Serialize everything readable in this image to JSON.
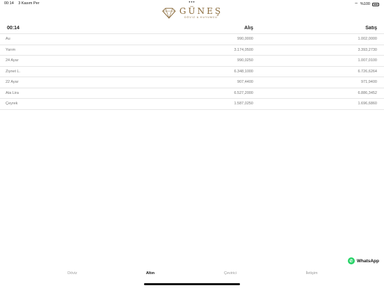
{
  "status_bar": {
    "time": "00:14",
    "date": "3 Kasım Per",
    "battery": "%100"
  },
  "logo": {
    "name": "GÜNEŞ",
    "tagline": "DÖVİZ & KUYUMCU"
  },
  "table": {
    "time": "00:14",
    "buy_header": "Alış",
    "sell_header": "Satış",
    "rows": [
      {
        "name": "Au",
        "buy": "990,0000",
        "sell": "1.002,0000"
      },
      {
        "name": "Yarım",
        "buy": "3.174,0500",
        "sell": "3.393,2730"
      },
      {
        "name": "24 Ayar",
        "buy": "990,0250",
        "sell": "1.007,0100"
      },
      {
        "name": "Ziynet L.",
        "buy": "6.348,1000",
        "sell": "6.726,6264"
      },
      {
        "name": "22 Ayar",
        "buy": "907,4400",
        "sell": "971,9400"
      },
      {
        "name": "Ata Lira",
        "buy": "6.527,2000",
        "sell": "6.886,3452"
      },
      {
        "name": "Çeyrek",
        "buy": "1.587,0250",
        "sell": "1.696,6860"
      }
    ]
  },
  "whatsapp": {
    "label": "WhatsApp"
  },
  "tabs": [
    {
      "label": "Döviz"
    },
    {
      "label": "Altın"
    },
    {
      "label": "Çevirici"
    },
    {
      "label": "İletişim"
    }
  ]
}
